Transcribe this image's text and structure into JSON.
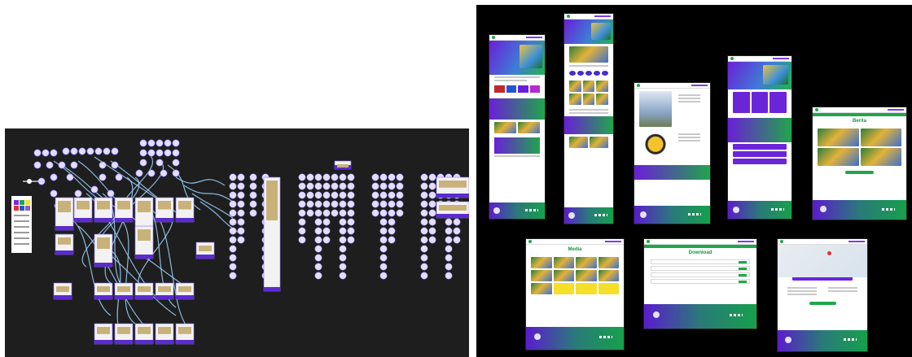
{
  "screens": [
    {
      "key": "home",
      "title": "",
      "sections": [
        "hero",
        "text",
        "icons",
        "band",
        "photos",
        "band",
        "news"
      ]
    },
    {
      "key": "tall",
      "title": "",
      "sections": [
        "hero",
        "text",
        "icons",
        "photos",
        "band",
        "photos",
        "photos",
        "band"
      ]
    },
    {
      "key": "profil",
      "title": "",
      "sections": [
        "hero",
        "text",
        "building",
        "badge",
        "band"
      ]
    },
    {
      "key": "program",
      "title": "",
      "sections": [
        "hero",
        "cards",
        "band",
        "purple"
      ]
    },
    {
      "key": "berita",
      "title": "Berita",
      "sections": [
        "photos"
      ]
    },
    {
      "key": "media",
      "title": "Media",
      "sections": [
        "photos",
        "yellow"
      ]
    },
    {
      "key": "download",
      "title": "Download",
      "sections": [
        "table"
      ]
    },
    {
      "key": "kontak",
      "title": "",
      "sections": [
        "map",
        "form"
      ]
    }
  ],
  "colors": {
    "canvas_left": "#1e1e1e",
    "canvas_right": "#000000",
    "node": "#e6dcff",
    "connector": "#9fd3ff",
    "brand_green": "#1fa64a",
    "brand_purple": "#6a1fd8",
    "accent_yellow": "#f5df2a"
  },
  "icons": {
    "flow_node": "circle",
    "flow_connector": "curve"
  }
}
